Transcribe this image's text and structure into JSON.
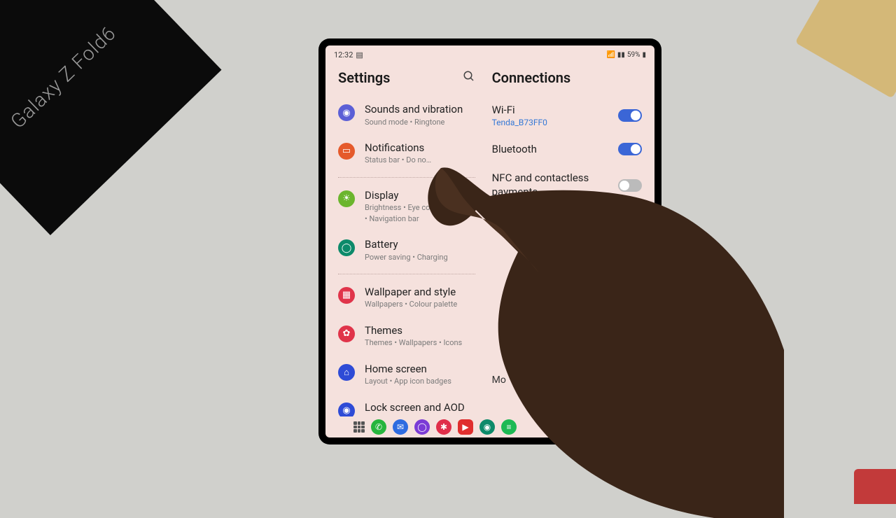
{
  "status": {
    "time": "12:32",
    "battery": "59%"
  },
  "leftPanel": {
    "title": "Settings",
    "items": [
      {
        "icon_bg": "#5b5fd6",
        "glyph": "◉",
        "title": "Sounds and vibration",
        "subtitle": "Sound mode  •  Ringtone"
      },
      {
        "icon_bg": "#e55a2b",
        "glyph": "▭",
        "title": "Notifications",
        "subtitle": "Status bar  •  Do no…"
      },
      {
        "icon_bg": "#6bb52d",
        "glyph": "☀",
        "title": "Display",
        "subtitle": "Brightness  •  Eye comfort shield  •  Navigation bar"
      },
      {
        "icon_bg": "#0d8a6a",
        "glyph": "◯",
        "title": "Battery",
        "subtitle": "Power saving  •  Charging"
      },
      {
        "icon_bg": "#e0344a",
        "glyph": "▦",
        "title": "Wallpaper and style",
        "subtitle": "Wallpapers  •  Colour palette"
      },
      {
        "icon_bg": "#e0344a",
        "glyph": "✿",
        "title": "Themes",
        "subtitle": "Themes  •  Wallpapers  •  Icons"
      },
      {
        "icon_bg": "#2e4bd6",
        "glyph": "⌂",
        "title": "Home screen",
        "subtitle": "Layout  •  App icon badges"
      },
      {
        "icon_bg": "#2e4bd6",
        "glyph": "◉",
        "title": "Lock screen and AOD",
        "subtitle": ""
      }
    ]
  },
  "rightPanel": {
    "title": "Connections",
    "items": [
      {
        "title": "Wi-Fi",
        "sub": "Tenda_B73FF0",
        "on": true
      },
      {
        "title": "Bluetooth",
        "sub": "",
        "on": true
      },
      {
        "title": "NFC and contactless payments",
        "sub": "",
        "on": false
      }
    ],
    "more": "Mo"
  },
  "box": {
    "label": "Galaxy Z Fold6"
  },
  "taskbar": {
    "icons": [
      {
        "bg": "#27b53e",
        "glyph": "✆"
      },
      {
        "bg": "#2e6be0",
        "glyph": "✉"
      },
      {
        "bg": "#7b3bd6",
        "glyph": "◯"
      },
      {
        "bg": "#e02e4a",
        "glyph": "✱"
      },
      {
        "bg": "#e02e2e",
        "glyph": "▶"
      },
      {
        "bg": "#0d8a6a",
        "glyph": "◉"
      },
      {
        "bg": "#1db954",
        "glyph": "≡"
      }
    ]
  }
}
